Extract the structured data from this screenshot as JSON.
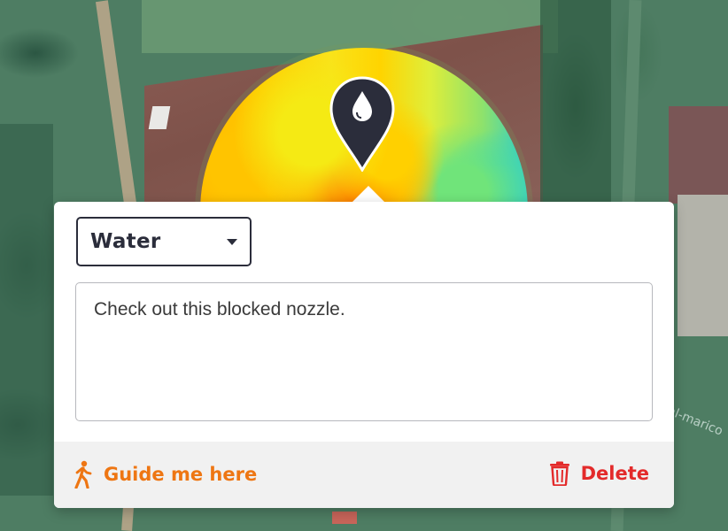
{
  "map": {
    "label": "al-marico"
  },
  "popup": {
    "pin_icon": "water-drop-pin-icon",
    "category_select": {
      "selected": "Water",
      "icon": "caret-down-icon"
    },
    "note_text": "Check out this blocked nozzle.",
    "actions": {
      "guide_label": "Guide me here",
      "guide_icon": "walking-person-icon",
      "delete_label": "Delete",
      "delete_icon": "trash-icon"
    }
  },
  "colors": {
    "accent_orange": "#ee7613",
    "danger_red": "#e32a2a",
    "dark": "#2b2d3b"
  }
}
